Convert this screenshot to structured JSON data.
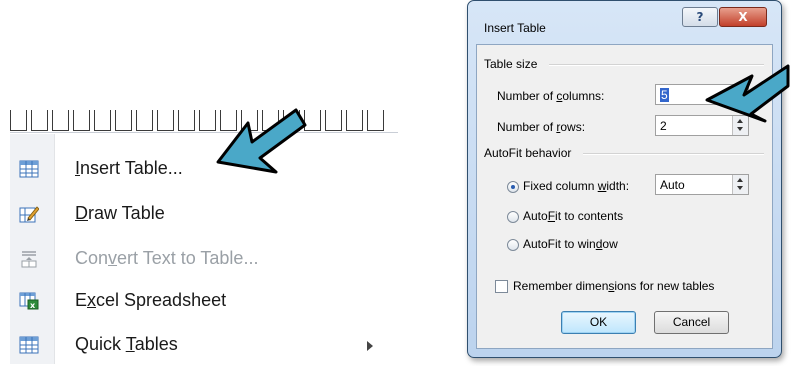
{
  "menu": {
    "items": [
      {
        "label_before": "",
        "mnemonic": "I",
        "label_after": "nsert Table...",
        "icon": "insert-table-icon",
        "enabled": true,
        "submenu": false
      },
      {
        "label_before": "",
        "mnemonic": "D",
        "label_after": "raw Table",
        "icon": "draw-table-icon",
        "enabled": true,
        "submenu": false
      },
      {
        "label_before": "Con",
        "mnemonic": "v",
        "label_after": "ert Text to Table...",
        "icon": "convert-text-icon",
        "enabled": false,
        "submenu": false
      },
      {
        "label_before": "E",
        "mnemonic": "x",
        "label_after": "cel Spreadsheet",
        "icon": "excel-spreadsheet-icon",
        "enabled": true,
        "submenu": false
      },
      {
        "label_before": "Quick ",
        "mnemonic": "T",
        "label_after": "ables",
        "icon": "quick-tables-icon",
        "enabled": true,
        "submenu": true
      }
    ]
  },
  "dialog": {
    "title": "Insert Table",
    "help_label": "?",
    "close_label": "X",
    "table_size": {
      "heading": "Table size",
      "columns_label_before": "Number of ",
      "columns_mnemonic": "c",
      "columns_label_after": "olumns:",
      "columns_value": "5",
      "rows_label_before": "Number of ",
      "rows_mnemonic": "r",
      "rows_label_after": "ows:",
      "rows_value": "2"
    },
    "autofit": {
      "heading": "AutoFit behavior",
      "fixed_before": "Fixed column ",
      "fixed_mnemonic": "w",
      "fixed_after": "idth:",
      "fixed_value": "Auto",
      "contents_before": "Auto",
      "contents_mnemonic": "F",
      "contents_after": "it to contents",
      "window_before": "AutoFit to win",
      "window_mnemonic": "d",
      "window_after": "ow",
      "selected": "fixed"
    },
    "remember_before": "Remember dimen",
    "remember_mnemonic": "s",
    "remember_after": "ions for new tables",
    "ok_label": "OK",
    "cancel_label": "Cancel"
  },
  "colors": {
    "arrow_fill": "#4aa8c8",
    "arrow_outline": "#000000",
    "dialog_frame": "#c4d9f1",
    "close_button": "#c2402a",
    "selection": "#3366cc"
  }
}
